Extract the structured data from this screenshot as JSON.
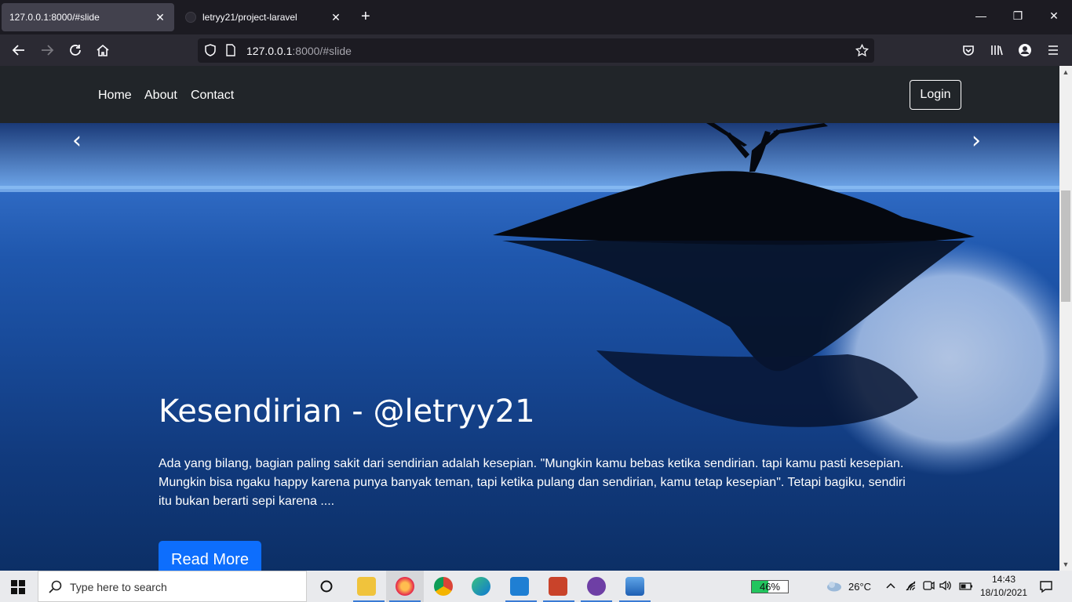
{
  "browser": {
    "tabs": [
      {
        "title": "127.0.0.1:8000/#slide",
        "active": true
      },
      {
        "title": "letryy21/project-laravel",
        "active": false
      }
    ],
    "url_host": "127.0.0.1",
    "url_rest": ":8000/#slide"
  },
  "site": {
    "nav": {
      "home": "Home",
      "about": "About",
      "contact": "Contact",
      "login": "Login"
    },
    "hero": {
      "title": "Kesendirian - @letryy21",
      "text": "Ada yang bilang, bagian paling sakit dari sendirian adalah kesepian. \"Mungkin kamu bebas ketika sendirian. tapi kamu pasti kesepian. Mungkin bisa ngaku happy karena punya banyak teman, tapi ketika pulang dan sendirian, kamu tetap kesepian\". Tetapi bagiku, sendiri itu bukan berarti sepi karena ....",
      "button": "Read More"
    }
  },
  "taskbar": {
    "search_placeholder": "Type here to search",
    "battery_percent": "46%",
    "battery_level": 0.46,
    "weather": "26°C",
    "time": "14:43",
    "date": "18/10/2021"
  },
  "colors": {
    "accent": "#0d6efd",
    "navbar": "#212529",
    "chrome": "#2b2a33"
  }
}
